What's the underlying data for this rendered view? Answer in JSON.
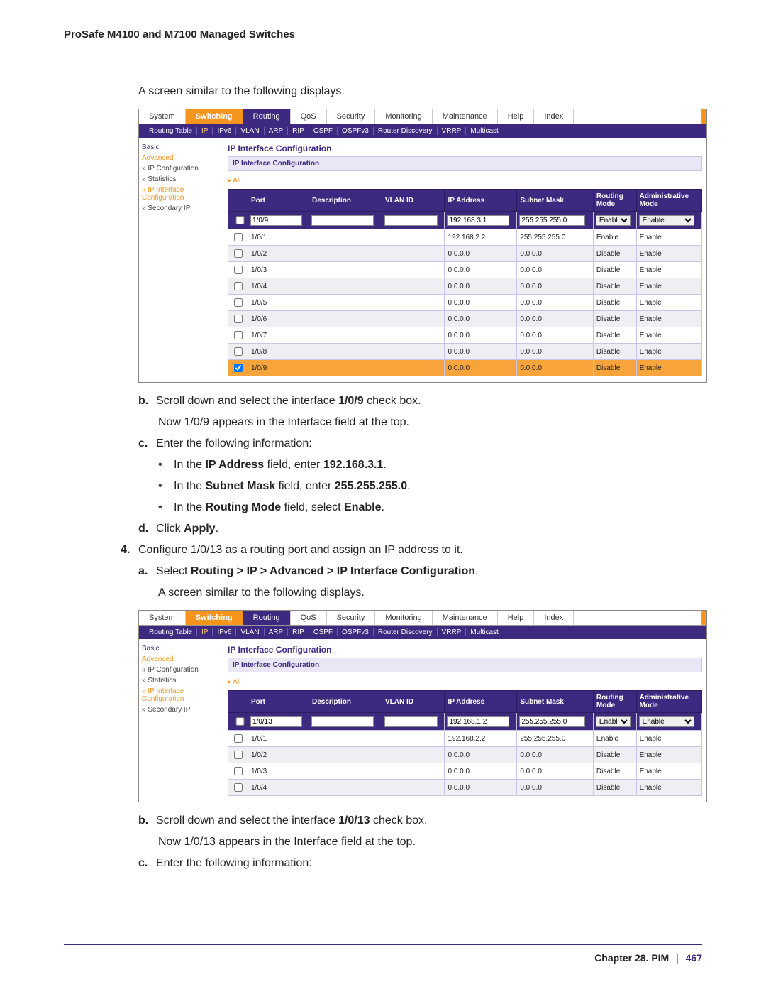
{
  "header": "ProSafe M4100 and M7100 Managed Switches",
  "intro1": "A screen similar to the following displays.",
  "shot1": {
    "top_tabs": [
      "System",
      "Switching",
      "Routing",
      "QoS",
      "Security",
      "Monitoring",
      "Maintenance",
      "Help",
      "Index"
    ],
    "active_tab": "Switching",
    "routing_tab": "Routing",
    "sub_nav": [
      "Routing Table",
      "IP",
      "IPv6",
      "VLAN",
      "ARP",
      "RIP",
      "OSPF",
      "OSPFv3",
      "Router Discovery",
      "VRRP",
      "Multicast"
    ],
    "sidebar": [
      {
        "label": "Basic",
        "cls": "link"
      },
      {
        "label": "Advanced",
        "cls": "cur"
      },
      {
        "label": "» IP Configuration",
        "cls": ""
      },
      {
        "label": "» Statistics",
        "cls": ""
      },
      {
        "label": "» IP Interface Configuration",
        "cls": "cur"
      },
      {
        "label": "» Secondary IP",
        "cls": ""
      }
    ],
    "section_title": "IP Interface Configuration",
    "section_bar": "IP Interface Configuration",
    "all": "All",
    "cols": [
      "",
      "Port",
      "Description",
      "VLAN ID",
      "IP Address",
      "Subnet Mask",
      "Routing Mode",
      "Administrative Mode"
    ],
    "editor": {
      "port": "1/0/9",
      "ip": "192.168.3.1",
      "mask": "255.255.255.0",
      "rmode": "Enable",
      "amode": "Enable"
    },
    "rows": [
      {
        "chk": false,
        "port": "1/0/1",
        "desc": "",
        "vlan": "",
        "ip": "192.168.2.2",
        "mask": "255.255.255.0",
        "rmode": "Enable",
        "amode": "Enable",
        "alt": false
      },
      {
        "chk": false,
        "port": "1/0/2",
        "desc": "",
        "vlan": "",
        "ip": "0.0.0.0",
        "mask": "0.0.0.0",
        "rmode": "Disable",
        "amode": "Enable",
        "alt": true
      },
      {
        "chk": false,
        "port": "1/0/3",
        "desc": "",
        "vlan": "",
        "ip": "0.0.0.0",
        "mask": "0.0.0.0",
        "rmode": "Disable",
        "amode": "Enable",
        "alt": false
      },
      {
        "chk": false,
        "port": "1/0/4",
        "desc": "",
        "vlan": "",
        "ip": "0.0.0.0",
        "mask": "0.0.0.0",
        "rmode": "Disable",
        "amode": "Enable",
        "alt": true
      },
      {
        "chk": false,
        "port": "1/0/5",
        "desc": "",
        "vlan": "",
        "ip": "0.0.0.0",
        "mask": "0.0.0.0",
        "rmode": "Disable",
        "amode": "Enable",
        "alt": false
      },
      {
        "chk": false,
        "port": "1/0/6",
        "desc": "",
        "vlan": "",
        "ip": "0.0.0.0",
        "mask": "0.0.0.0",
        "rmode": "Disable",
        "amode": "Enable",
        "alt": true
      },
      {
        "chk": false,
        "port": "1/0/7",
        "desc": "",
        "vlan": "",
        "ip": "0.0.0.0",
        "mask": "0.0.0.0",
        "rmode": "Disable",
        "amode": "Enable",
        "alt": false
      },
      {
        "chk": false,
        "port": "1/0/8",
        "desc": "",
        "vlan": "",
        "ip": "0.0.0.0",
        "mask": "0.0.0.0",
        "rmode": "Disable",
        "amode": "Enable",
        "alt": true
      },
      {
        "chk": true,
        "port": "1/0/9",
        "desc": "",
        "vlan": "",
        "ip": "0.0.0.0",
        "mask": "0.0.0.0",
        "rmode": "Disable",
        "amode": "Enable",
        "alt": false,
        "sel": true
      }
    ]
  },
  "steps": {
    "b1_pre": "Scroll down and select the interface ",
    "b1_bold": "1/0/9",
    "b1_post": " check box.",
    "b1_line2": "Now 1/0/9 appears in the Interface field at the top.",
    "c1": "Enter the following information:",
    "bul1_pre": "In the ",
    "bul1_b": "IP Address",
    "bul1_mid": " field, enter ",
    "bul1_v": "192.168.3.1",
    "bul1_post": ".",
    "bul2_pre": "In the ",
    "bul2_b": "Subnet Mask",
    "bul2_mid": " field, enter ",
    "bul2_v": "255.255.255.0",
    "bul2_post": ".",
    "bul3_pre": "In the ",
    "bul3_b": "Routing Mode",
    "bul3_mid": " field, select ",
    "bul3_v": "Enable",
    "bul3_post": ".",
    "d1_pre": "Click ",
    "d1_b": "Apply",
    "d1_post": ".",
    "s4": "Configure 1/0/13 as a routing port and assign an IP address to it.",
    "a2_pre": "Select ",
    "a2_b": "Routing > IP > Advanced > IP Interface Configuration",
    "a2_post": ".",
    "a2_line2": "A screen similar to the following displays."
  },
  "shot2": {
    "editor": {
      "port": "1/0/13",
      "ip": "192.168.1.2",
      "mask": "255.255.255.0",
      "rmode": "Enable",
      "amode": "Enable"
    },
    "rows": [
      {
        "chk": false,
        "port": "1/0/1",
        "desc": "",
        "vlan": "",
        "ip": "192.168.2.2",
        "mask": "255.255.255.0",
        "rmode": "Enable",
        "amode": "Enable",
        "alt": false
      },
      {
        "chk": false,
        "port": "1/0/2",
        "desc": "",
        "vlan": "",
        "ip": "0.0.0.0",
        "mask": "0.0.0.0",
        "rmode": "Disable",
        "amode": "Enable",
        "alt": true
      },
      {
        "chk": false,
        "port": "1/0/3",
        "desc": "",
        "vlan": "",
        "ip": "0.0.0.0",
        "mask": "0.0.0.0",
        "rmode": "Disable",
        "amode": "Enable",
        "alt": false
      },
      {
        "chk": false,
        "port": "1/0/4",
        "desc": "",
        "vlan": "",
        "ip": "0.0.0.0",
        "mask": "0.0.0.0",
        "rmode": "Disable",
        "amode": "Enable",
        "alt": true
      }
    ]
  },
  "steps2": {
    "b2_pre": "Scroll down and select the interface ",
    "b2_bold": "1/0/13",
    "b2_post": " check box.",
    "b2_line2": "Now 1/0/13 appears in the Interface field at the top.",
    "c2": "Enter the following information:"
  },
  "footer": {
    "chapter": "Chapter 28.  PIM",
    "page": "467"
  }
}
